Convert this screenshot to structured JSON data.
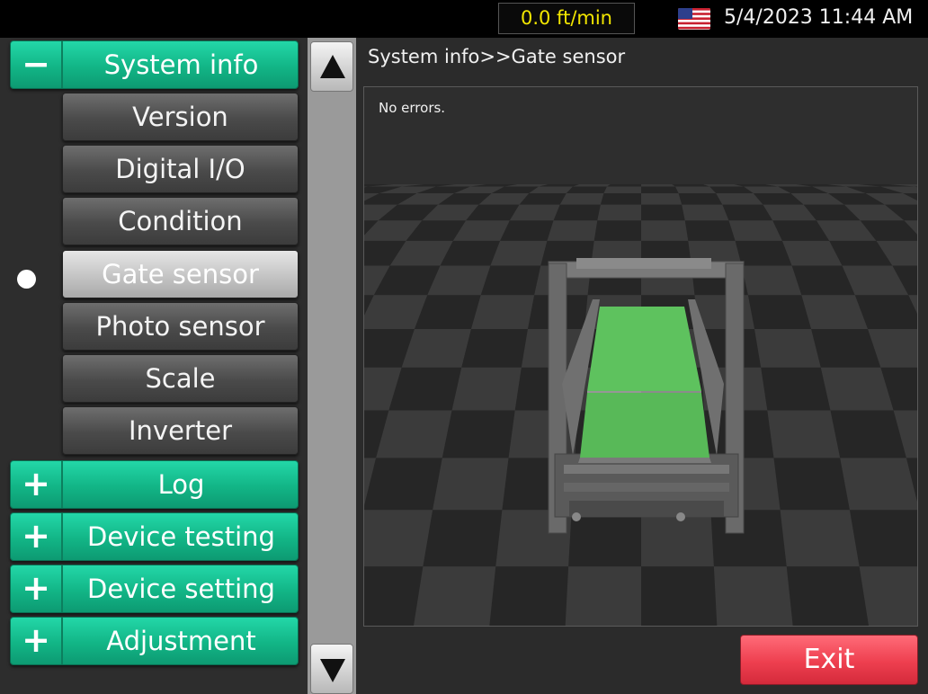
{
  "header": {
    "speed": "0.0 ft/min",
    "datetime": "5/4/2023 11:44 AM",
    "flag_icon": "us-flag-icon"
  },
  "menu": {
    "categories": [
      {
        "sign": "−",
        "label": "System info"
      },
      {
        "sign": "+",
        "label": "Log"
      },
      {
        "sign": "+",
        "label": "Device testing"
      },
      {
        "sign": "+",
        "label": "Device setting"
      },
      {
        "sign": "+",
        "label": "Adjustment"
      }
    ],
    "subitems": [
      {
        "label": "Version"
      },
      {
        "label": "Digital I/O"
      },
      {
        "label": "Condition"
      },
      {
        "label": "Gate sensor"
      },
      {
        "label": "Photo sensor"
      },
      {
        "label": "Scale"
      },
      {
        "label": "Inverter"
      }
    ],
    "active_subitem": "Gate sensor"
  },
  "content": {
    "breadcrumb": "System info>>Gate sensor",
    "status": "No errors."
  },
  "exit_label": "Exit",
  "colors": {
    "accent_green": "#12b586",
    "exit_red": "#ee3f4f",
    "speed_yellow": "#f2e600",
    "belt_green": "#5ec25e"
  }
}
